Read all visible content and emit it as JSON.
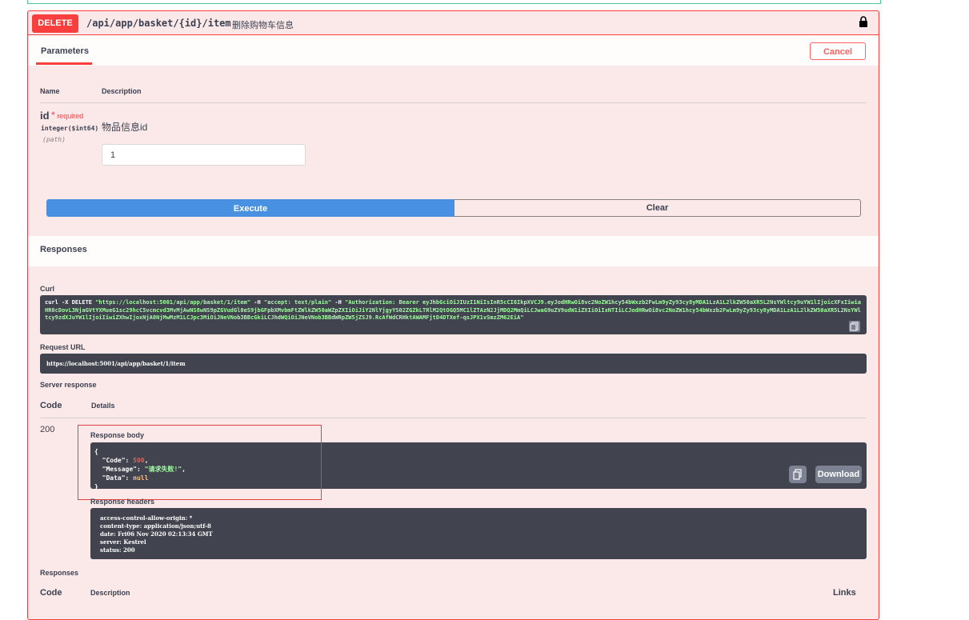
{
  "operation": {
    "method": "DELETE",
    "path": "/api/app/basket/{id}/item",
    "summary": "删除购物车信息"
  },
  "tabs": {
    "parameters": "Parameters",
    "cancel": "Cancel"
  },
  "param_table": {
    "name_header": "Name",
    "description_header": "Description"
  },
  "param": {
    "name": "id",
    "required_mark": "*",
    "required_text": "required",
    "type": "integer($int64)",
    "in": "(path)",
    "description": "物品信息id",
    "value": "1"
  },
  "actions": {
    "execute": "Execute",
    "clear": "Clear"
  },
  "responses_section": {
    "title": "Responses",
    "curl_label": "Curl",
    "curl_prefix": "curl -X DELETE ",
    "curl_url": "\"https://localhost:5001/api/app/basket/1/item\"",
    "curl_h1": " -H  ",
    "curl_accept": "\"accept: text/plain\"",
    "curl_h2": " -H  ",
    "curl_auth": "\"Authorization: Bearer eyJhbGciOiJIUzI1NiIsInR5cCI6IkpXVCJ9.eyJodHRwOi8vc2NoZW1hcy54bWxzb2FwLm9yZy93cy8yMDA1LzA1L2lkZW50aXR5L2NsYWltcy9uYW1lIjoicXFxIiwiaHR0cDovL3NjaGVtYXMueG1sc29hcC5vcmcvd3MvMjAwNS8wNS9pZGVudGl0eS9jbGFpbXMvbmFtZWlkZW50aWZpZXIiOiJiY2NlYjgyYS02ZGZkLTRlM2QtOGQ5MC1lZTAzN2JjMDQ2MmQiLCJwaG9uZV9udW1iZXIiOiIxNTIiLCJodHRwOi8vc2NoZW1hcy54bWxzb2FwLm9yZy93cy8yMDA1LzA1L2lkZW50aXR5L2NsYWltcy9zdXJuYW1lIjoiIiwiZXhwIjoxNjA0NjMwMzM1LCJpc3MiOiJNeVNob3BBcGkiLCJhdWQiOiJNeVNob3BBdWRpZW5jZSJ9.RcAfWdCRHktAWAMFjtD4DTXef-qsJPX1vSmzZM62EiA\"",
    "request_url_label": "Request URL",
    "request_url": "https://localhost:5001/api/app/basket/1/item",
    "server_response_label": "Server response",
    "code_header": "Code",
    "details_header": "Details",
    "status_code": "200",
    "response_body_label": "Response body",
    "body": {
      "open": "{",
      "code_key": "  \"Code\": ",
      "code_val": "500",
      "message_key": "  \"Message\": ",
      "message_val": "\"请求失败!\"",
      "data_key": "  \"Data\": ",
      "data_val": "null",
      "close": "}"
    },
    "download": "Download",
    "response_headers_label": "Response headers",
    "headers": [
      "access-control-allow-origin: *",
      "content-type: application/json;utf-8",
      "date: Fri06 Nov 2020 02:13:34 GMT",
      "server: Kestrel",
      "status: 200"
    ],
    "responses_label": "Responses",
    "bottom_code_header": "Code",
    "bottom_description_header": "Description",
    "bottom_links_header": "Links"
  },
  "colors": {
    "delete": "#f93e3e",
    "execute": "#4990e2",
    "block_bg": "#fbe8e8",
    "code_bg": "#41444e"
  },
  "icons": {
    "lock": "lock-icon",
    "copy": "copy-icon"
  }
}
